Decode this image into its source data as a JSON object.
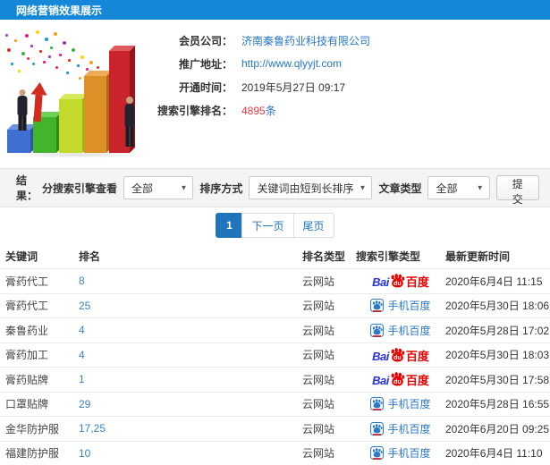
{
  "header": {
    "title": "网络营销效果展示"
  },
  "info": {
    "fields": [
      {
        "label": "会员公司：",
        "value": "济南秦鲁药业科技有限公司"
      },
      {
        "label": "推广地址：",
        "value": "http://www.qlyyjt.com"
      },
      {
        "label": "开通时间：",
        "value": "2019年5月27日 09:17"
      },
      {
        "label": "搜索引擎排名：",
        "value": "4895",
        "suffix": "条"
      }
    ]
  },
  "filters": {
    "result_label": "结果：",
    "engine_label": "分搜索引擎查看",
    "engine_value": "全部",
    "sort_label": "排序方式",
    "sort_value": "关键词由短到长排序",
    "article_label": "文章类型",
    "article_value": "全部",
    "submit_label": "提交"
  },
  "pagination": {
    "current": "1",
    "next": "下一页",
    "last": "尾页"
  },
  "table": {
    "headers": [
      "关键词",
      "排名",
      "排名类型",
      "搜索引擎类型",
      "最新更新时间"
    ],
    "rows": [
      {
        "keyword": "膏药代工",
        "rank": "8",
        "rank_type": "云网站",
        "engine": "baidu",
        "updated": "2020年6月4日 11:15"
      },
      {
        "keyword": "膏药代工",
        "rank": "25",
        "rank_type": "云网站",
        "engine": "mobile",
        "updated": "2020年5月30日 18:06"
      },
      {
        "keyword": "秦鲁药业",
        "rank": "4",
        "rank_type": "云网站",
        "engine": "mobile",
        "updated": "2020年5月28日 17:02"
      },
      {
        "keyword": "膏药加工",
        "rank": "4",
        "rank_type": "云网站",
        "engine": "baidu",
        "updated": "2020年5月30日 18:03"
      },
      {
        "keyword": "膏药贴牌",
        "rank": "1",
        "rank_type": "云网站",
        "engine": "baidu",
        "updated": "2020年5月30日 17:58"
      },
      {
        "keyword": "口罩贴牌",
        "rank": "29",
        "rank_type": "云网站",
        "engine": "mobile",
        "updated": "2020年5月28日 16:55"
      },
      {
        "keyword": "金华防护服",
        "rank": "17,25",
        "rank_type": "云网站",
        "engine": "mobile",
        "updated": "2020年6月20日 09:25"
      },
      {
        "keyword": "福建防护服",
        "rank": "10",
        "rank_type": "云网站",
        "engine": "mobile",
        "updated": "2020年6月4日 11:10"
      }
    ]
  },
  "engines": {
    "baidu": {
      "bai": "Bai",
      "du": "du",
      "cn": "百度"
    },
    "mobile": {
      "label": "手机百度"
    }
  },
  "colors": {
    "header_blue": "#1487d8",
    "link_blue": "#2577c8",
    "rank_red": "#e4393c",
    "baidu_red": "#e10602",
    "baidu_blue": "#2932e1",
    "mobile_blue": "#2c7ac8",
    "pager_blue": "#1f74bb"
  }
}
